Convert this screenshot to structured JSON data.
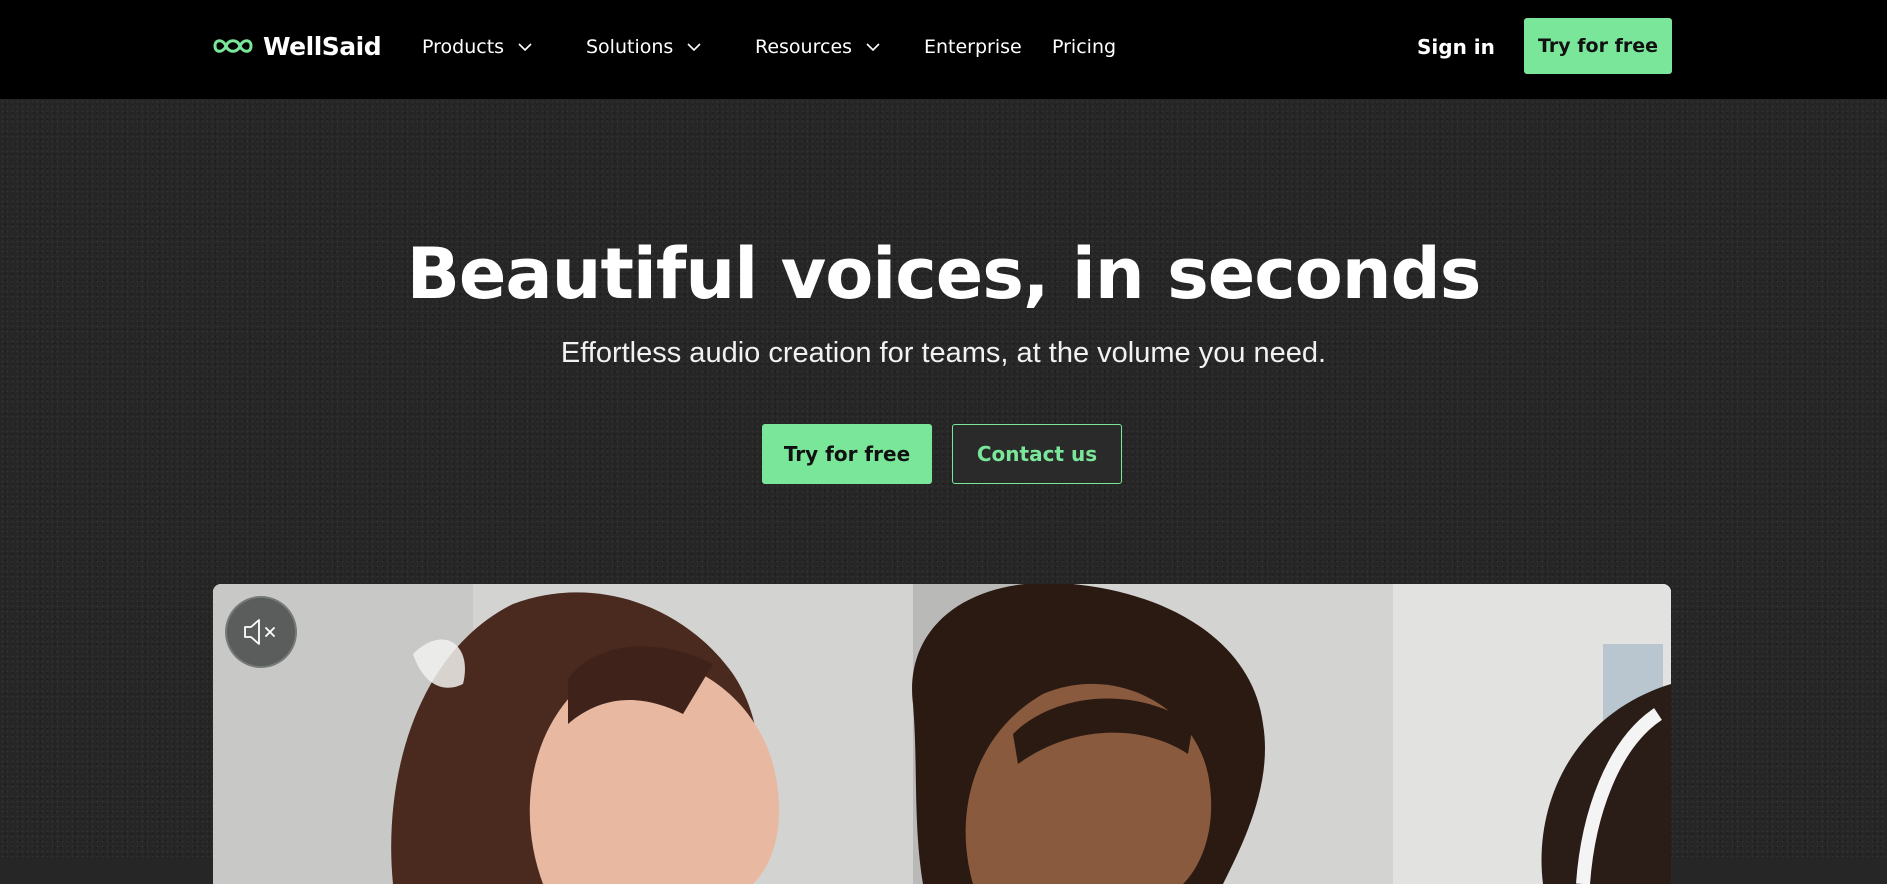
{
  "brand": {
    "name": "WellSaid",
    "accent_color": "#7ae69a",
    "logo_icon": "wellsaid-logo-icon"
  },
  "nav": {
    "items": [
      {
        "label": "Products",
        "has_dropdown": true
      },
      {
        "label": "Solutions",
        "has_dropdown": true
      },
      {
        "label": "Resources",
        "has_dropdown": true
      },
      {
        "label": "Enterprise",
        "has_dropdown": false
      },
      {
        "label": "Pricing",
        "has_dropdown": false
      }
    ],
    "sign_in_label": "Sign in",
    "cta_label": "Try for free"
  },
  "hero": {
    "title": "Beautiful voices, in seconds",
    "subtitle": "Effortless audio creation for teams, at the volume you need.",
    "primary_cta_label": "Try for free",
    "secondary_cta_label": "Contact us"
  },
  "media": {
    "mute_icon": "speaker-muted-icon",
    "muted": true
  }
}
